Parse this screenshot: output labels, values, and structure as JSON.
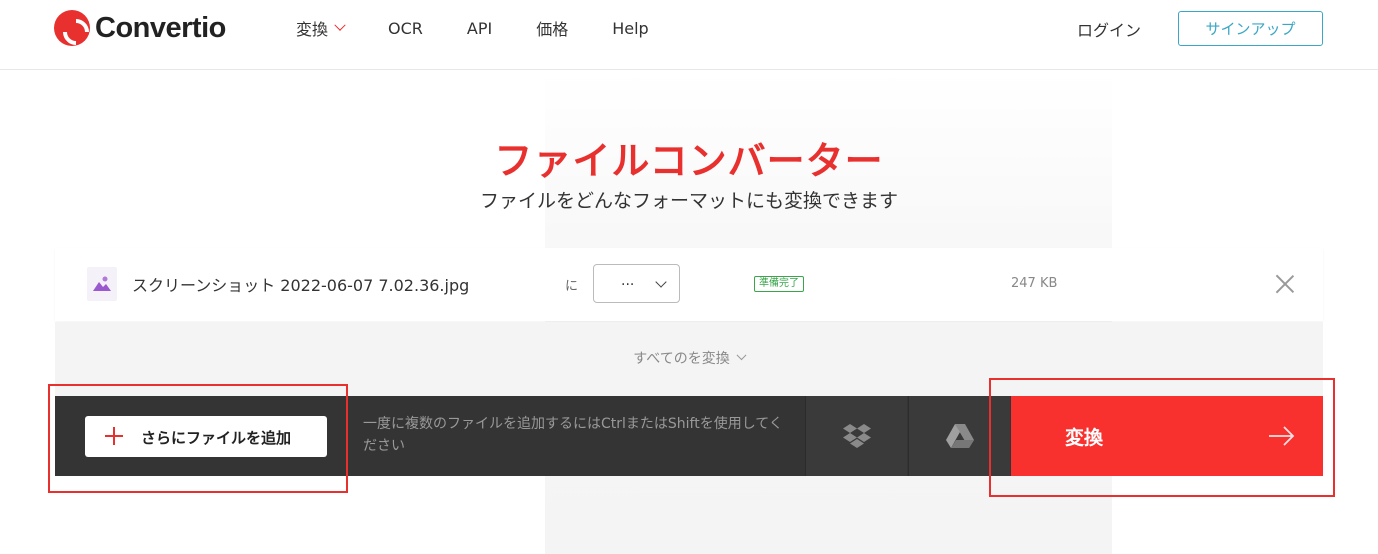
{
  "brand": {
    "name": "Convertio",
    "accent": "#e8312f"
  },
  "nav": {
    "items": [
      {
        "label": "変換",
        "has_dropdown": true
      },
      {
        "label": "OCR",
        "has_dropdown": false
      },
      {
        "label": "API",
        "has_dropdown": false
      },
      {
        "label": "価格",
        "has_dropdown": false
      },
      {
        "label": "Help",
        "has_dropdown": false
      }
    ],
    "login_label": "ログイン",
    "signup_label": "サインアップ"
  },
  "hero": {
    "title": "ファイルコンバーター",
    "subtitle": "ファイルをどんなフォーマットにも変換できます"
  },
  "file": {
    "name": "スクリーンショット 2022-06-07 7.02.36.jpg",
    "to_label": "に",
    "format_value": "...",
    "status": "準備完了",
    "size": "247 KB",
    "icon": "image-file-icon"
  },
  "convert_all_label": "すべてのを変換",
  "action_bar": {
    "add_more_label": "さらにファイルを追加",
    "hint": "一度に複数のファイルを追加するにはCtrlまたはShiftを使用してください",
    "dropbox_icon": "dropbox-icon",
    "gdrive_icon": "google-drive-icon",
    "convert_label": "変換"
  },
  "colors": {
    "accent_red": "#e8312f",
    "signup_blue": "#3aa7c6",
    "status_green": "#3aa54b",
    "bar_dark": "#343434",
    "convert_red": "#f8312f"
  }
}
